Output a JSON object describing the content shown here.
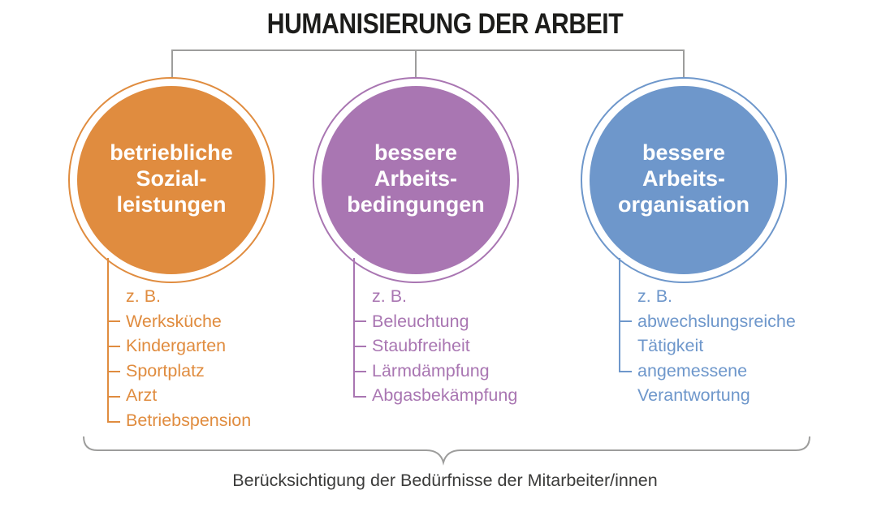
{
  "title": "HUMANISIERUNG DER ARBEIT",
  "colors": {
    "orange": "#e08c3f",
    "purple": "#a976b2",
    "blue": "#6e97cb",
    "connector": "#9d9d9c"
  },
  "branches": [
    {
      "circle_lines": [
        "betriebliche",
        "Sozial-",
        "leistungen"
      ],
      "items": [
        "z. B.",
        "Werksküche",
        "Kindergarten",
        "Sportplatz",
        "Arzt",
        "Betriebspension"
      ]
    },
    {
      "circle_lines": [
        "bessere",
        "Arbeits-",
        "bedingungen"
      ],
      "items": [
        "z. B.",
        "Beleuchtung",
        "Staubfreiheit",
        "Lärmdämpfung",
        "Abgasbekämpfung"
      ]
    },
    {
      "circle_lines": [
        "bessere",
        "Arbeits-",
        "organisation"
      ],
      "items": [
        "z. B.",
        "abwechslungsreiche",
        "Tätigkeit",
        "angemessene",
        "Verantwortung"
      ]
    }
  ],
  "footer": "Berücksichtigung der Bedürfnisse der Mitarbeiter/innen"
}
